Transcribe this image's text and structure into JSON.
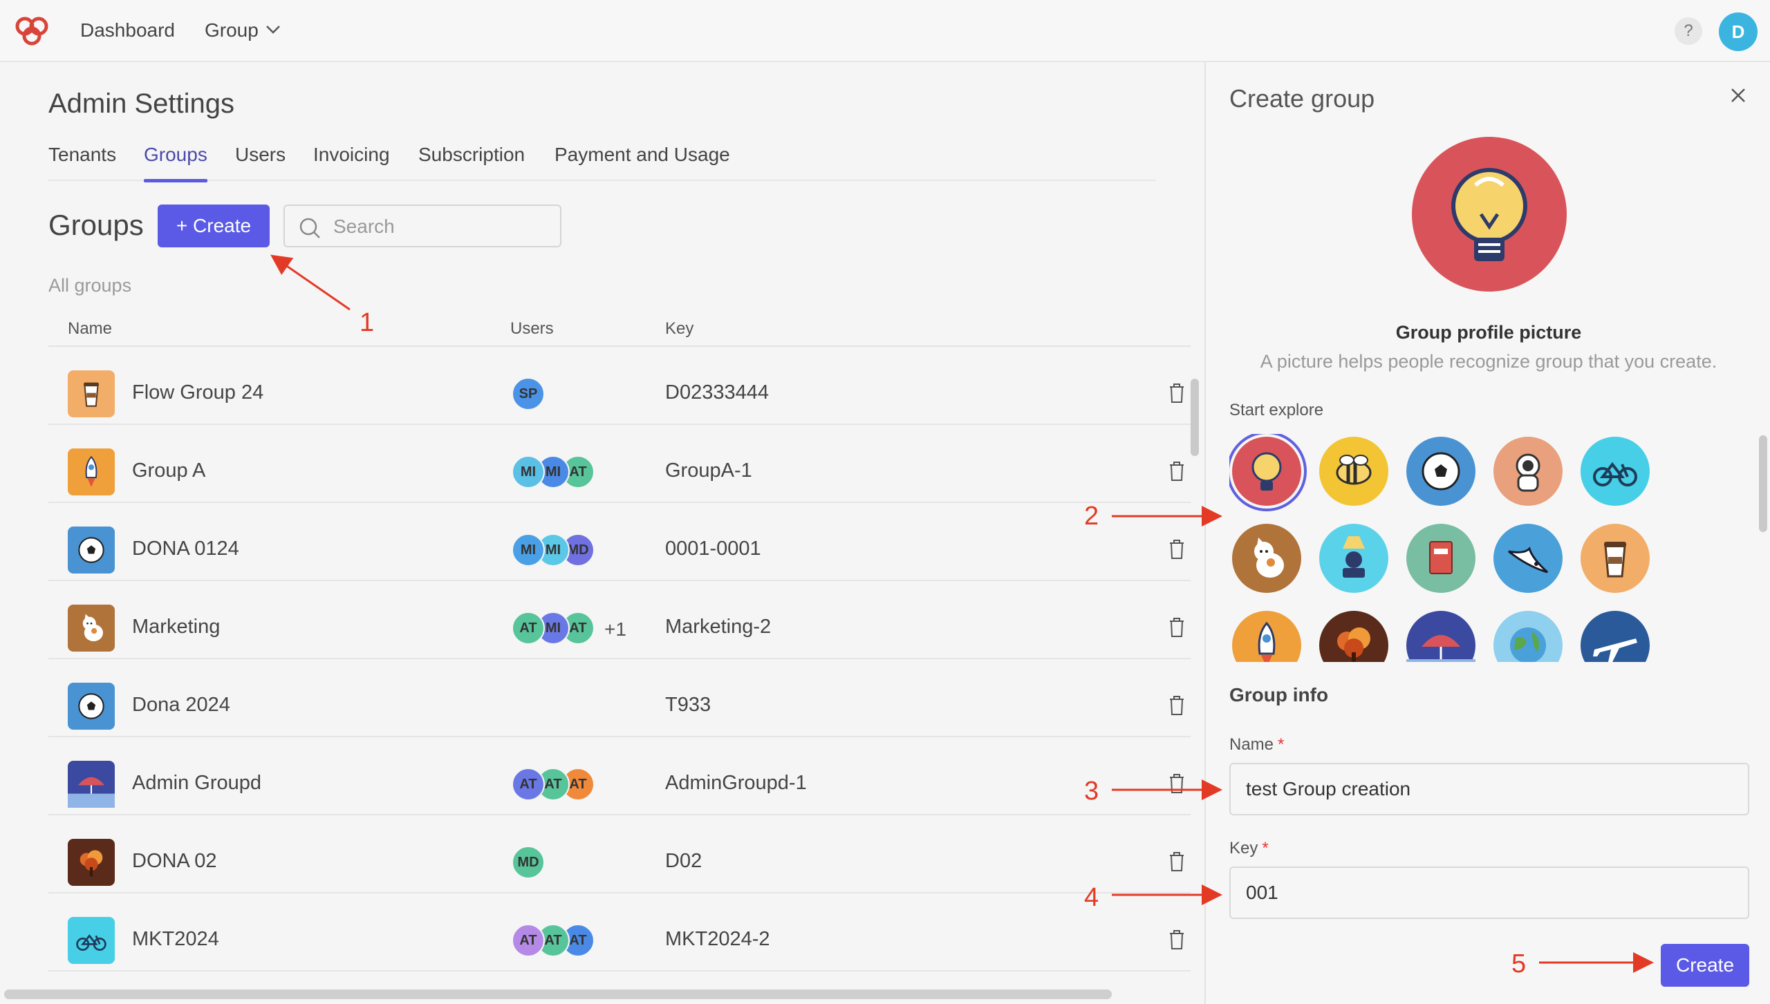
{
  "nav": {
    "dashboard": "Dashboard",
    "group": "Group",
    "help": "?",
    "avatar_initial": "D"
  },
  "page": {
    "title": "Admin Settings",
    "tabs": [
      "Tenants",
      "Groups",
      "Users",
      "Invoicing",
      "Subscription",
      "Payment and Usage"
    ],
    "active_tab": "Groups"
  },
  "groups": {
    "heading": "Groups",
    "create_label": "+ Create",
    "search_placeholder": "Search",
    "all_groups_label": "All groups",
    "columns": {
      "name": "Name",
      "users": "Users",
      "key": "Key"
    },
    "rows": [
      {
        "name": "Flow Group 24",
        "icon": "coffee-cup-icon",
        "users": [
          "SP"
        ],
        "extra": "",
        "key": "D02333444"
      },
      {
        "name": "Group A",
        "icon": "rocket-icon",
        "users": [
          "MI",
          "MI",
          "AT"
        ],
        "extra": "",
        "key": "GroupA-1"
      },
      {
        "name": "DONA 0124",
        "icon": "soccer-ball-icon",
        "users": [
          "MI",
          "MI",
          "MD"
        ],
        "extra": "",
        "key": "0001-0001"
      },
      {
        "name": "Marketing",
        "icon": "cat-icon",
        "users": [
          "AT",
          "MI",
          "AT"
        ],
        "extra": "+1",
        "key": "Marketing-2"
      },
      {
        "name": "Dona 2024",
        "icon": "soccer-ball-icon",
        "users": [],
        "extra": "",
        "key": "T933"
      },
      {
        "name": "Admin Groupd",
        "icon": "umbrella-icon",
        "users": [
          "AT",
          "AT",
          "AT"
        ],
        "extra": "",
        "key": "AdminGroupd-1"
      },
      {
        "name": "DONA 02",
        "icon": "tree-icon",
        "users": [
          "MD"
        ],
        "extra": "",
        "key": "D02"
      },
      {
        "name": "MKT2024",
        "icon": "bicycle-icon",
        "users": [
          "AT",
          "AT",
          "AT"
        ],
        "extra": "",
        "key": "MKT2024-2"
      }
    ]
  },
  "panel": {
    "title": "Create group",
    "profile_label": "Group profile picture",
    "profile_sub": "A picture helps people recognize group that you create.",
    "start_explore": "Start explore",
    "pictures": [
      "lightbulb-icon",
      "bee-icon",
      "soccer-ball-icon",
      "astronaut-icon",
      "bicycle-icon",
      "cat-icon",
      "lamp-reader-icon",
      "book-icon",
      "bird-icon",
      "coffee-cup-icon",
      "rocket-icon",
      "tree-icon",
      "umbrella-icon",
      "globe-icon",
      "airplane-icon"
    ],
    "selected_picture": "lightbulb-icon",
    "info_title": "Group info",
    "name_label": "Name",
    "name_value": "test Group creation",
    "key_label": "Key",
    "key_value": "001",
    "required_mark": "*",
    "submit_label": "Create"
  },
  "annotations": [
    "1",
    "2",
    "3",
    "4",
    "5"
  ],
  "colors": {
    "accent": "#5a5ae6",
    "annotation": "#e33a25",
    "selected_picture_bg": "#d9545a"
  }
}
